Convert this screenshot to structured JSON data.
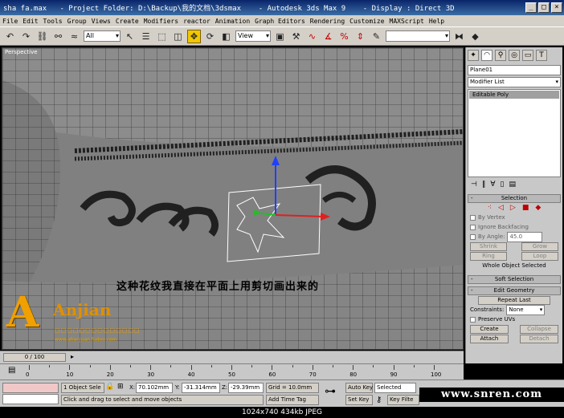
{
  "window": {
    "title": "sha fa.max   - Project Folder: D:\\Backup\\我的文档\\3dsmax    - Autodesk 3ds Max 9    - Display : Direct 3D",
    "minimize": "_",
    "maximize": "□",
    "close": "×"
  },
  "menu": [
    "File",
    "Edit",
    "Tools",
    "Group",
    "Views",
    "Create",
    "Modifiers",
    "reactor",
    "Animation",
    "Graph Editors",
    "Rendering",
    "Customize",
    "MAXScript",
    "Help"
  ],
  "toolbar": {
    "selection_filter": "All",
    "ref_coord": "View",
    "named_sel": ""
  },
  "viewport": {
    "label": "Perspective",
    "overlay_text": "这种花纹我直接在平面上用剪切画出来的"
  },
  "logo": {
    "letter": "A",
    "brand": "Anjian",
    "sub": "□□□□□□□□□□□□□□",
    "url": "www.ahanjuan.fudoo.com"
  },
  "command_panel": {
    "object_name": "Plane01",
    "modifier_list": "Modifier List",
    "stack_item": "Editable Poly",
    "selection_title": "Selection",
    "by_vertex": "By Vertex",
    "ignore_backfacing": "Ignore Backfacing",
    "by_angle": "By Angle:",
    "angle_value": "45.0",
    "shrink": "Shrink",
    "grow": "Grow",
    "ring": "Ring",
    "loop": "Loop",
    "whole_object": "Whole Object Selected",
    "soft_selection": "Soft Selection",
    "edit_geometry": "Edit Geometry",
    "repeat_last": "Repeat Last",
    "constraints": "Constraints:",
    "constraints_value": "None",
    "preserve_uvs": "Preserve UVs",
    "create": "Create",
    "collapse": "Collapse",
    "attach": "Attach",
    "detach": "Detach"
  },
  "timeline": {
    "frame": "0 / 100",
    "ticks": [
      "0",
      "10",
      "20",
      "30",
      "40",
      "50",
      "60",
      "70",
      "80",
      "90",
      "100"
    ]
  },
  "status": {
    "objects": "1 Object Sele",
    "x_label": "X:",
    "x_value": "70.102mm",
    "y_label": "Y:",
    "y_value": "-31.314mm",
    "z_label": "Z:",
    "z_value": "-29.39mm",
    "grid": "Grid = 10.0mm",
    "prompt": "Click and drag to select and move objects",
    "add_time_tag": "Add Time Tag",
    "auto_key": "Auto Key",
    "selected": "Selected",
    "set_key": "Set Key",
    "key_filters": "Key Filte"
  },
  "watermark": "www.snren.com",
  "caption": "1024x740  434kb  JPEG",
  "colors": {
    "viewport_bg": "#808080",
    "active_tool": "#f0c800",
    "logo": "#f0a000"
  }
}
